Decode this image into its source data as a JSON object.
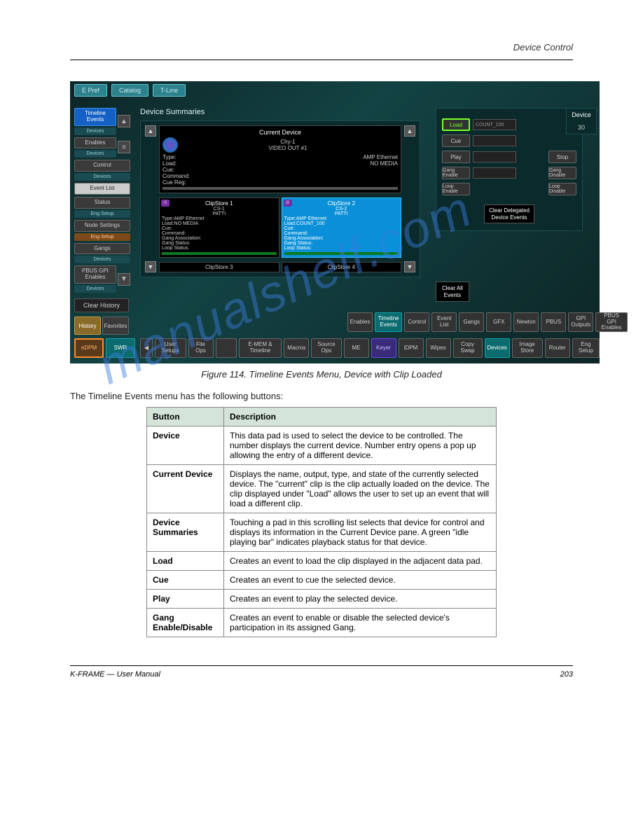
{
  "header": {
    "right": "Device Control"
  },
  "app": {
    "top_tabs": [
      "E Pref",
      "Catalog",
      "T-Line"
    ],
    "sidebar": [
      {
        "label": "Timeline Events",
        "sub": "Devices",
        "active": true
      },
      {
        "label": "Enables",
        "sub": "Devices"
      },
      {
        "label": "Control",
        "sub": "Devices"
      },
      {
        "label": "Event List"
      },
      {
        "label": "Status",
        "sub": "Eng Setup"
      },
      {
        "label": "Node Settings",
        "sub": "Eng Setup",
        "orange": true
      },
      {
        "label": "Gangs",
        "sub": "Devices"
      },
      {
        "label": "PBUS GPI Enables",
        "sub": "Devices"
      }
    ],
    "clear_history": "Clear History",
    "history": "History",
    "favorites": "Favorites",
    "devpanel": {
      "title": "Device Summaries",
      "current": {
        "hdr": "Current Device",
        "name": "Chy-1",
        "out": "VIDEO OUT #1",
        "type_l": "Type:",
        "type_v": "AMP Ethernet",
        "load_l": "Load:",
        "load_v": "NO MEDIA",
        "cue_l": "Cue:",
        "cmd_l": "Command:",
        "cr_l": "Cue Reg:"
      },
      "cards": [
        {
          "title": "ClipStore 1",
          "name": "CS-1",
          "sub": "PATTI",
          "type": "AMP Ethernet",
          "load": "NO MEDIA"
        },
        {
          "title": "ClipStore 2",
          "name": "CS-2",
          "sub": "PATTI",
          "type": "AMP Ethernet",
          "load": "COUNT_100",
          "selected": true
        }
      ],
      "labels": {
        "type": "Type:",
        "load": "Load:",
        "cue": "Cue:",
        "cmd": "Command:",
        "ga": "Gang Association:",
        "gs": "Gang Status:",
        "ls": "Loop Status:"
      },
      "mini": [
        "ClipStore 3",
        "ClipStore 4"
      ]
    },
    "controls": {
      "buttons": {
        "load": "Load",
        "cue": "Cue",
        "play": "Play",
        "gang_enable": "Gang Enable",
        "loop_enable": "Loop Enable",
        "stop": "Stop",
        "gang_disable": "Gang Disable",
        "loop_disable": "Loop Disable"
      },
      "load_value": "COUNT_100",
      "cdd1": "Clear Delegated",
      "cdd2": "Device Events"
    },
    "clear_all1": "Clear All",
    "clear_all2": "Events",
    "device_label": "Device",
    "device_value": "30",
    "row_a": [
      "Enables",
      "Timeline Events",
      "Control",
      "Event List",
      "Gangs",
      "GFX",
      "Newton",
      "PBUS",
      "GPI Outputs",
      "PBUS GPI Enables"
    ],
    "row_b": [
      "User Setups",
      "File Ops",
      "",
      "E-MEM & Timeline",
      "Macros",
      "Source Ops",
      "ME",
      "Keyer",
      "iDPM",
      "Wipes",
      "Copy Swap",
      "Devices",
      "Image Store",
      "Router",
      "Eng Setup"
    ],
    "mode": {
      "edpm": "eDPM",
      "swr": "SWR"
    }
  },
  "caption": "Figure 114.  Timeline Events Menu, Device with Clip Loaded",
  "para": "The Timeline Events menu has the following buttons:",
  "table": [
    {
      "b": "Device",
      "d": "This data pad is used to select the device to be controlled. The number displays the current device. Number entry opens a pop up allowing the entry of a different device."
    },
    {
      "b": "Current Device",
      "d": "Displays the name, output, type, and state of the currently selected device. The \"current\" clip is the clip actually loaded on the device. The clip displayed under \"Load\" allows the user to set up an event that will load a different clip."
    },
    {
      "b": "Device Summaries",
      "d": "Touching a pad in this scrolling list selects that device for control and displays its information in the Current Device pane. A green \"idle playing bar\" indicates playback status for that device."
    },
    {
      "b": "Load",
      "d": "Creates an event to load the clip displayed in the adjacent data pad."
    },
    {
      "b": "Cue",
      "d": "Creates an event to cue the selected device."
    },
    {
      "b": "Play",
      "d": "Creates an event to play the selected device."
    },
    {
      "b": "Gang Enable/Disable",
      "d": "Creates an event to enable or disable the selected device's participation in its assigned Gang."
    }
  ],
  "footer": {
    "left": "K-FRAME — User Manual",
    "right": "203"
  },
  "watermark": "manualshelf.com"
}
